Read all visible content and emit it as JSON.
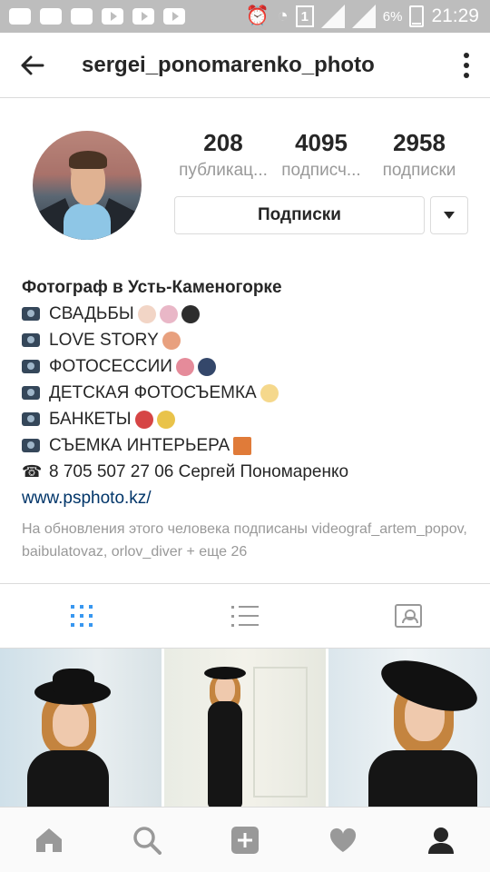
{
  "status_bar": {
    "battery_percent": "6%",
    "time": "21:29",
    "sim_label": "1"
  },
  "header": {
    "username": "sergei_ponomarenko_photo"
  },
  "profile": {
    "stats": [
      {
        "number": "208",
        "label": "публикац..."
      },
      {
        "number": "4095",
        "label": "подписч..."
      },
      {
        "number": "2958",
        "label": "подписки"
      }
    ],
    "follow_button": "Подписки"
  },
  "bio": {
    "name": "Фотограф в Усть-Каменогорке",
    "lines": [
      "СВАДЬБЫ",
      "LOVE STORY",
      "ФОТОСЕССИИ",
      "ДЕТСКАЯ ФОТОСЪЕМКА",
      "БАНКЕТЫ",
      "СЪЕМКА ИНТЕРЬЕРА"
    ],
    "phone_icon": "☎",
    "phone": "8 705 507 27 06 Сергей Пономаренко",
    "link": "www.psphoto.kz/",
    "followed_by": "На обновления этого человека подписаны videograf_artem_popov, baibulatovaz, orlov_diver + еще 26"
  },
  "icons": {
    "back": "arrow-left-icon",
    "more": "more-vertical-icon",
    "grid": "grid-icon",
    "list": "list-icon",
    "tagged": "tagged-photos-icon",
    "home": "home-icon",
    "search": "search-icon",
    "add": "add-post-icon",
    "activity": "heart-icon",
    "profile": "profile-icon"
  },
  "colors": {
    "status_bar": "#bdbdbd",
    "active_tab": "#3897f0",
    "link": "#003569",
    "muted": "#999999"
  }
}
